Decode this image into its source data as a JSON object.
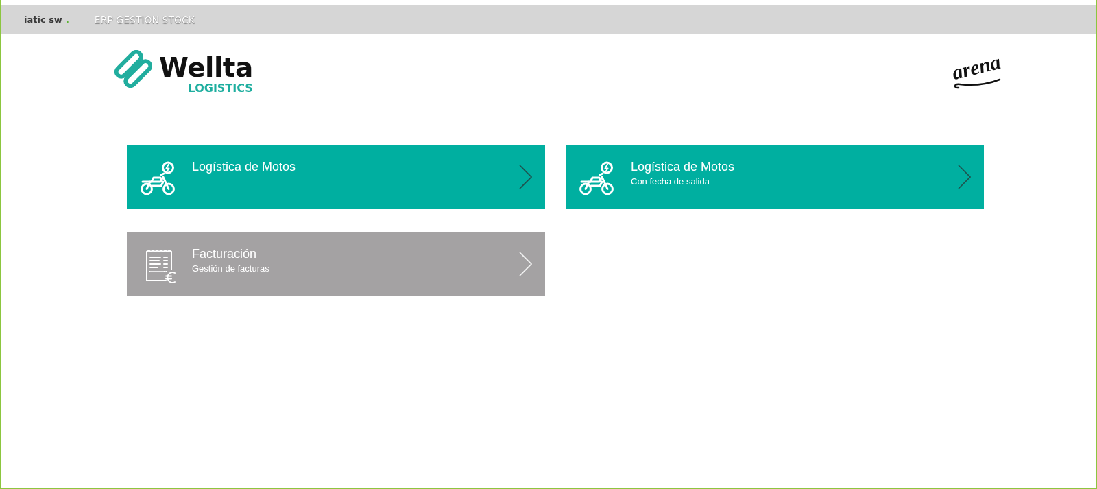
{
  "top_bar": {
    "brand": "iatic sw",
    "brand_dot": ".",
    "app_title": "ERP GESTION STOCK"
  },
  "header": {
    "left_logo": {
      "wordmark": "Wellta",
      "tagline": "LOGISTICS"
    },
    "right_logo": {
      "wordmark": "arena"
    }
  },
  "tiles": [
    {
      "kind": "motorcycle",
      "title": "Logística de Motos",
      "color": "#00afa0"
    },
    {
      "kind": "motorcycle",
      "title": "Logística de Motos",
      "subtitle": "Con fecha de salida",
      "color": "#00afa0"
    },
    {
      "kind": "invoice",
      "title": "Facturación",
      "subtitle": "Gestión de facturas",
      "color": "#a4a2a3"
    }
  ]
}
